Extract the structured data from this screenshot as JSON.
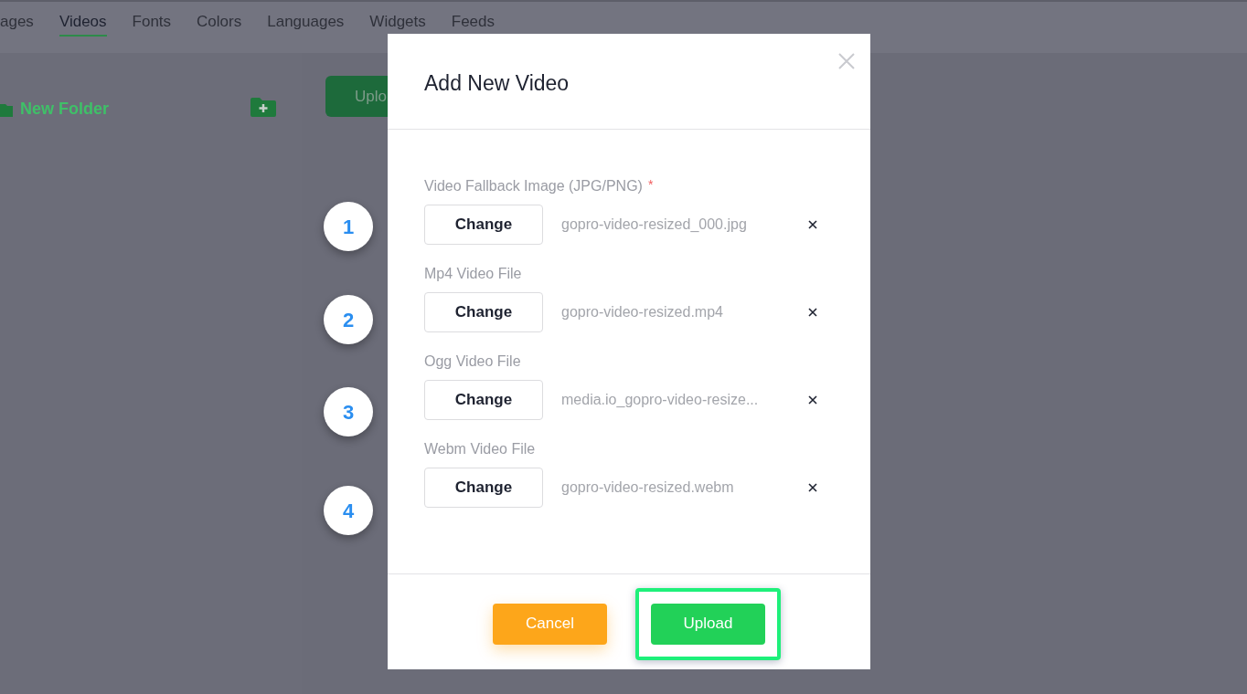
{
  "tabs": [
    {
      "label": "ages",
      "selected": false
    },
    {
      "label": "Videos",
      "selected": true
    },
    {
      "label": "Fonts",
      "selected": false
    },
    {
      "label": "Colors",
      "selected": false
    },
    {
      "label": "Languages",
      "selected": false
    },
    {
      "label": "Widgets",
      "selected": false
    },
    {
      "label": "Feeds",
      "selected": false
    }
  ],
  "sidebar": {
    "new_folder": "New Folder"
  },
  "upload_button": "Uplo",
  "modal": {
    "title": "Add New Video",
    "required_mark": "*",
    "fields": [
      {
        "step": "1",
        "label": "Video Fallback Image (JPG/PNG)",
        "required": true,
        "button": "Change",
        "file": "gopro-video-resized_000.jpg"
      },
      {
        "step": "2",
        "label": "Mp4 Video File",
        "required": false,
        "button": "Change",
        "file": "gopro-video-resized.mp4"
      },
      {
        "step": "3",
        "label": "Ogg Video File",
        "required": false,
        "button": "Change",
        "file": "media.io_gopro-video-resize..."
      },
      {
        "step": "4",
        "label": "Webm Video File",
        "required": false,
        "button": "Change",
        "file": "gopro-video-resized.webm"
      }
    ],
    "buttons": [
      {
        "label": "Cancel",
        "kind": "cancel",
        "highlighted": false
      },
      {
        "label": "Upload",
        "kind": "primary",
        "highlighted": true
      }
    ]
  }
}
